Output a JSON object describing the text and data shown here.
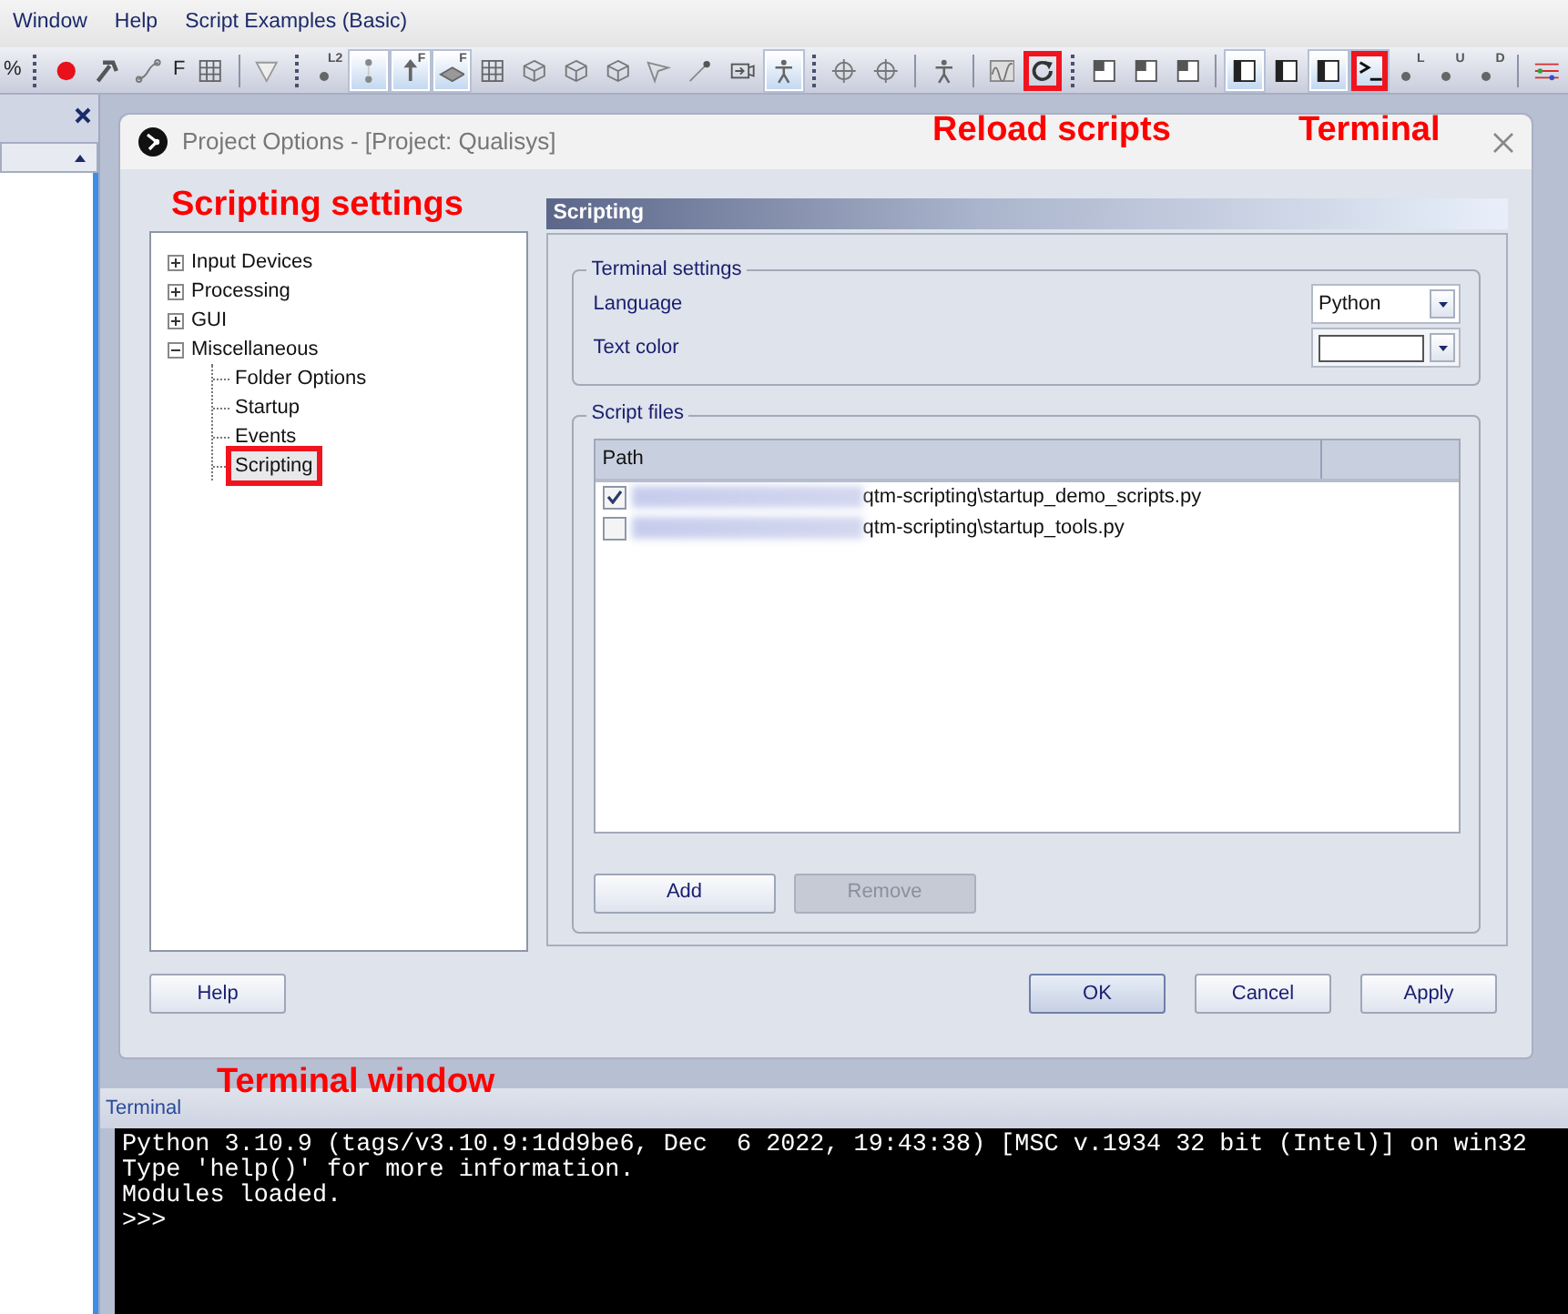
{
  "menu": [
    "Window",
    "Help",
    "Script Examples (Basic)"
  ],
  "toolbar": [
    {
      "kind": "text",
      "label": "%"
    },
    {
      "kind": "grip"
    },
    {
      "kind": "record",
      "pressed": false,
      "highlighted": false
    },
    {
      "kind": "hammer",
      "pressed": false,
      "highlighted": false
    },
    {
      "kind": "curve",
      "pressed": false,
      "highlighted": false
    },
    {
      "kind": "text",
      "label": "F"
    },
    {
      "kind": "grid",
      "pressed": false,
      "highlighted": false
    },
    {
      "kind": "separator"
    },
    {
      "kind": "triangle",
      "pressed": false,
      "highlighted": false
    },
    {
      "kind": "grip"
    },
    {
      "kind": "dot",
      "label": "L2",
      "pressed": false,
      "highlighted": false
    },
    {
      "kind": "segment",
      "pressed": true,
      "highlighted": false
    },
    {
      "kind": "arrow",
      "label": "F",
      "pressed": true,
      "highlighted": false
    },
    {
      "kind": "diamond",
      "label": "F",
      "pressed": true,
      "highlighted": false
    },
    {
      "kind": "grid",
      "pressed": false,
      "highlighted": false
    },
    {
      "kind": "cube",
      "pressed": false,
      "highlighted": false
    },
    {
      "kind": "cube",
      "pressed": false,
      "highlighted": false
    },
    {
      "kind": "cube",
      "pressed": false,
      "highlighted": false
    },
    {
      "kind": "plane",
      "pressed": false,
      "highlighted": false
    },
    {
      "kind": "wand",
      "pressed": false,
      "highlighted": false
    },
    {
      "kind": "camera",
      "pressed": false,
      "highlighted": false
    },
    {
      "kind": "figure",
      "pressed": true,
      "highlighted": false
    },
    {
      "kind": "grip"
    },
    {
      "kind": "crosshair",
      "pressed": false,
      "highlighted": false
    },
    {
      "kind": "crosshair",
      "pressed": false,
      "highlighted": false
    },
    {
      "kind": "separator"
    },
    {
      "kind": "figure",
      "pressed": false,
      "highlighted": false
    },
    {
      "kind": "separator"
    },
    {
      "kind": "wave",
      "pressed": false,
      "highlighted": false
    },
    {
      "kind": "reload",
      "pressed": false,
      "highlighted": true
    },
    {
      "kind": "grip"
    },
    {
      "kind": "pane",
      "pressed": false,
      "highlighted": false
    },
    {
      "kind": "pane",
      "pressed": false,
      "highlighted": false
    },
    {
      "kind": "pane",
      "pressed": false,
      "highlighted": false
    },
    {
      "kind": "separator"
    },
    {
      "kind": "layout",
      "pressed": true,
      "highlighted": false
    },
    {
      "kind": "layout",
      "pressed": false,
      "highlighted": false
    },
    {
      "kind": "layout",
      "pressed": true,
      "highlighted": false
    },
    {
      "kind": "terminal",
      "pressed": true,
      "highlighted": true
    },
    {
      "kind": "dot",
      "label": "L",
      "pressed": false,
      "highlighted": false
    },
    {
      "kind": "dot",
      "label": "U",
      "pressed": false,
      "highlighted": false
    },
    {
      "kind": "dot",
      "label": "D",
      "pressed": false,
      "highlighted": false
    },
    {
      "kind": "separator"
    },
    {
      "kind": "links",
      "pressed": false,
      "highlighted": false
    }
  ],
  "dialog": {
    "title": "Project Options - [Project: Qualisys]",
    "tree": [
      {
        "label": "Input Devices",
        "expanded": false,
        "selected": false,
        "highlighted": false
      },
      {
        "label": "Processing",
        "expanded": false,
        "selected": false,
        "highlighted": false
      },
      {
        "label": "GUI",
        "expanded": false,
        "selected": false,
        "highlighted": false
      },
      {
        "label": "Miscellaneous",
        "expanded": true,
        "selected": false,
        "highlighted": false,
        "children": [
          {
            "label": "Folder Options",
            "selected": false,
            "highlighted": false
          },
          {
            "label": "Startup",
            "selected": false,
            "highlighted": false
          },
          {
            "label": "Events",
            "selected": false,
            "highlighted": false
          },
          {
            "label": "Scripting",
            "selected": true,
            "highlighted": true
          }
        ]
      }
    ],
    "page_title": "Scripting",
    "terminal_settings": {
      "legend": "Terminal settings",
      "language": {
        "label": "Language",
        "value": "Python"
      },
      "text_color": {
        "label": "Text color",
        "color": "#ffffff"
      }
    },
    "script_files": {
      "legend": "Script files",
      "columns": [
        "Path"
      ],
      "rows": [
        {
          "checked": true,
          "path": "qtm-scripting\\startup_demo_scripts.py"
        },
        {
          "checked": false,
          "path": "qtm-scripting\\startup_tools.py"
        }
      ],
      "buttons": [
        {
          "label": "Add",
          "disabled": false
        },
        {
          "label": "Remove",
          "disabled": true
        }
      ]
    },
    "buttons": [
      {
        "label": "Help",
        "default": false
      },
      {
        "label": "OK",
        "default": true
      },
      {
        "label": "Cancel",
        "default": false
      },
      {
        "label": "Apply",
        "default": false
      }
    ]
  },
  "terminal": {
    "title": "Terminal",
    "lines": [
      "Python 3.10.9 (tags/v3.10.9:1dd9be6, Dec  6 2022, 19:43:38) [MSC v.1934 32 bit (Intel)] on win32",
      "Type 'help()' for more information.",
      "Modules loaded.",
      ">>>"
    ]
  },
  "callouts": [
    "Reload scripts",
    "Terminal",
    "Scripting settings",
    "Terminal window"
  ]
}
